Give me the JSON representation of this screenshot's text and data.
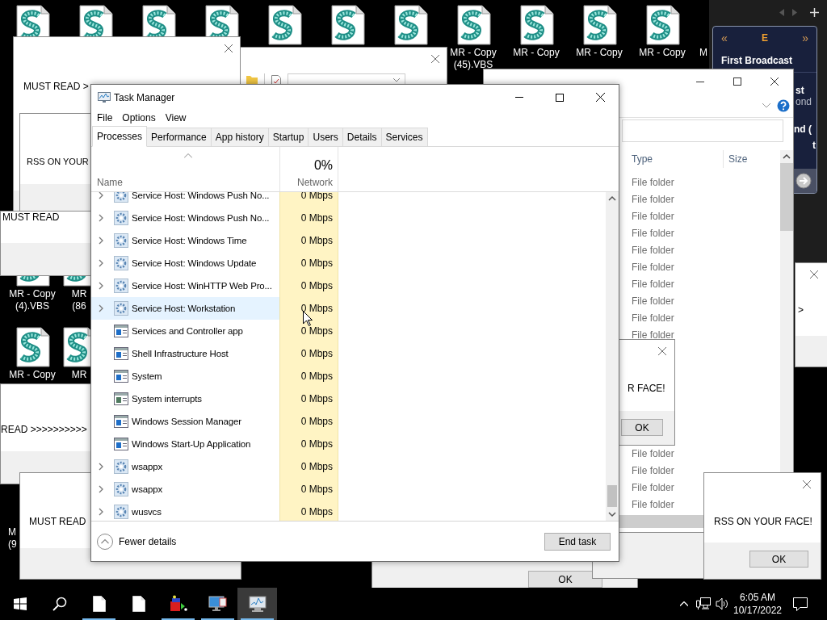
{
  "desktop_icons": [
    {
      "kind": "script"
    },
    {
      "kind": "script"
    },
    {
      "kind": "script"
    },
    {
      "kind": "script"
    },
    {
      "kind": "script"
    },
    {
      "kind": "script"
    },
    {
      "kind": "script"
    },
    {
      "kind": "script",
      "lines": [
        "MR - Copy",
        "(45).VBS"
      ]
    },
    {
      "kind": "script",
      "lines": [
        "MR - Copy"
      ]
    },
    {
      "kind": "script",
      "lines": [
        "MR - Copy"
      ]
    },
    {
      "kind": "script",
      "lines": [
        "MR - Copy"
      ]
    },
    {
      "kind": "label",
      "lines": [
        "M"
      ]
    },
    {
      "kind": "script",
      "lines": [
        "MR - Copy",
        "(4).VBS"
      ]
    },
    {
      "kind": "script",
      "lines": [
        "MR",
        "(86"
      ]
    },
    {
      "kind": "script",
      "lines": [
        "MR - Copy"
      ]
    },
    {
      "kind": "script",
      "lines": [
        "MR"
      ]
    },
    {
      "kind": "label",
      "lines": [
        "M",
        "(9"
      ]
    }
  ],
  "gadget": {
    "prev": "«",
    "label": "E",
    "next": "»",
    "items": [
      {
        "title": "First Broadcast"
      },
      {
        "title": "st",
        "subtitle": "ond"
      },
      {
        "title": "nd ("
      },
      {
        "title": "t"
      }
    ]
  },
  "windows": [
    {
      "kind": "folder",
      "closable": true
    },
    {
      "kind": "message",
      "text": "MUST READ >",
      "closable": true
    },
    {
      "kind": "message",
      "text": "RSS ON YOUR"
    },
    {
      "kind": "message",
      "text": "MUST READ"
    },
    {
      "kind": "message",
      "text": "READ >>>>>>>>>>"
    },
    {
      "kind": "message",
      "text": "MUST READ"
    },
    {
      "kind": "message",
      "button": "OK"
    },
    {
      "kind": "blank"
    },
    {
      "kind": "explorer",
      "columns": [
        "Type",
        "Size"
      ],
      "rows": [
        "File folder",
        "File folder",
        "File folder",
        "File folder",
        "File folder",
        "File folder",
        "File folder",
        "File folder",
        "File folder",
        "File folder",
        "File folder",
        "File folder",
        "File folder",
        "File folder"
      ]
    },
    {
      "kind": "message",
      "text": "R FACE!",
      "button": "OK",
      "closable": true
    },
    {
      "kind": "message",
      "text": ">",
      "closable": true
    },
    {
      "kind": "message",
      "text": "RSS ON YOUR FACE!",
      "button": "OK",
      "closable": true
    }
  ],
  "task_manager": {
    "title": "Task Manager",
    "menu": [
      "File",
      "Options",
      "View"
    ],
    "tabs": [
      {
        "label": "Processes",
        "selected": true
      },
      {
        "label": "Performance",
        "selected": false
      },
      {
        "label": "App history",
        "selected": false
      },
      {
        "label": "Startup",
        "selected": false
      },
      {
        "label": "Users",
        "selected": false
      },
      {
        "label": "Details",
        "selected": false
      },
      {
        "label": "Services",
        "selected": false
      }
    ],
    "columns": {
      "name": "Name",
      "network_usage": "0%",
      "network": "Network"
    },
    "rows": [
      {
        "name": "Service Host: Windows Push No...",
        "kind": "service",
        "expandable": true,
        "hovered": false,
        "network": "0 Mbps"
      },
      {
        "name": "Service Host: Windows Push No...",
        "kind": "service",
        "expandable": true,
        "hovered": false,
        "network": "0 Mbps"
      },
      {
        "name": "Service Host: Windows Time",
        "kind": "service",
        "expandable": true,
        "hovered": false,
        "network": "0 Mbps"
      },
      {
        "name": "Service Host: Windows Update",
        "kind": "service",
        "expandable": true,
        "hovered": false,
        "network": "0 Mbps"
      },
      {
        "name": "Service Host: WinHTTP Web Pro...",
        "kind": "service",
        "expandable": true,
        "hovered": false,
        "network": "0 Mbps"
      },
      {
        "name": "Service Host: Workstation",
        "kind": "service",
        "expandable": true,
        "hovered": true,
        "network": "0 Mbps"
      },
      {
        "name": "Services and Controller app",
        "kind": "app",
        "expandable": false,
        "hovered": false,
        "network": "0 Mbps"
      },
      {
        "name": "Shell Infrastructure Host",
        "kind": "app",
        "expandable": false,
        "hovered": false,
        "network": "0 Mbps"
      },
      {
        "name": "System",
        "kind": "app",
        "expandable": false,
        "hovered": false,
        "network": "0 Mbps"
      },
      {
        "name": "System interrupts",
        "kind": "interrupts",
        "expandable": false,
        "hovered": false,
        "network": "0 Mbps"
      },
      {
        "name": "Windows Session Manager",
        "kind": "app",
        "expandable": false,
        "hovered": false,
        "network": "0 Mbps"
      },
      {
        "name": "Windows Start-Up Application",
        "kind": "app",
        "expandable": false,
        "hovered": false,
        "network": "0 Mbps"
      },
      {
        "name": "wsappx",
        "kind": "service",
        "expandable": true,
        "hovered": false,
        "network": "0 Mbps"
      },
      {
        "name": "wsappx",
        "kind": "service",
        "expandable": true,
        "hovered": false,
        "network": "0 Mbps"
      },
      {
        "name": "wusvcs",
        "kind": "service",
        "expandable": true,
        "hovered": false,
        "network": "0 Mbps"
      }
    ],
    "fewer_details": "Fewer details",
    "end_task": "End task"
  },
  "taskbar": {
    "items": [
      {
        "kind": "start",
        "running": false,
        "active": false
      },
      {
        "kind": "search",
        "running": false,
        "active": false
      },
      {
        "kind": "file",
        "running": true,
        "active": false
      },
      {
        "kind": "file",
        "running": false,
        "active": false
      },
      {
        "kind": "app",
        "running": true,
        "active": false
      },
      {
        "kind": "monitor",
        "running": true,
        "active": false
      },
      {
        "kind": "taskmgr",
        "running": true,
        "active": true
      }
    ],
    "clock": {
      "time": "6:05 AM",
      "date": "10/17/2022"
    }
  }
}
